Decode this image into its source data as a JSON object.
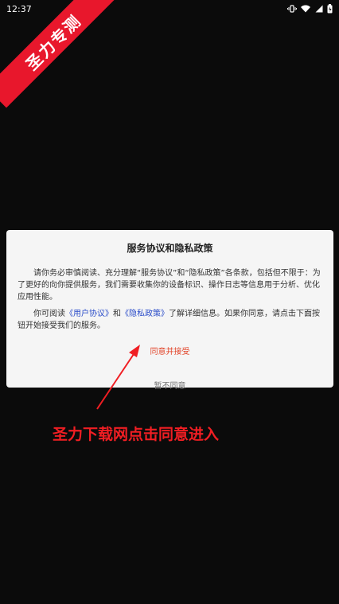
{
  "status_bar": {
    "time": "12:37"
  },
  "ribbon": {
    "text": "圣力专测"
  },
  "dialog": {
    "title": "服务协议和隐私政策",
    "para1": "请你务必审慎阅读、充分理解“服务协议”和“隐私政策”各条款，包括但不限于：为了更好的向你提供服务，我们需要收集你的设备标识、操作日志等信息用于分析、优化应用性能。",
    "para2_prefix": "你可阅读",
    "link_user_agreement": "《用户协议》",
    "para2_and": "和",
    "link_privacy_policy": "《隐私政策》",
    "para2_suffix": "了解详细信息。如果你同意，请点击下面按钮开始接受我们的服务。",
    "agree_label": "同意并接受",
    "disagree_label": "暂不同意"
  },
  "annotation": {
    "text": "圣力下载网点击同意进入"
  },
  "colors": {
    "accent_red": "#e8172c",
    "link_blue": "#2a4cc9",
    "agree_orange": "#e2452a"
  }
}
